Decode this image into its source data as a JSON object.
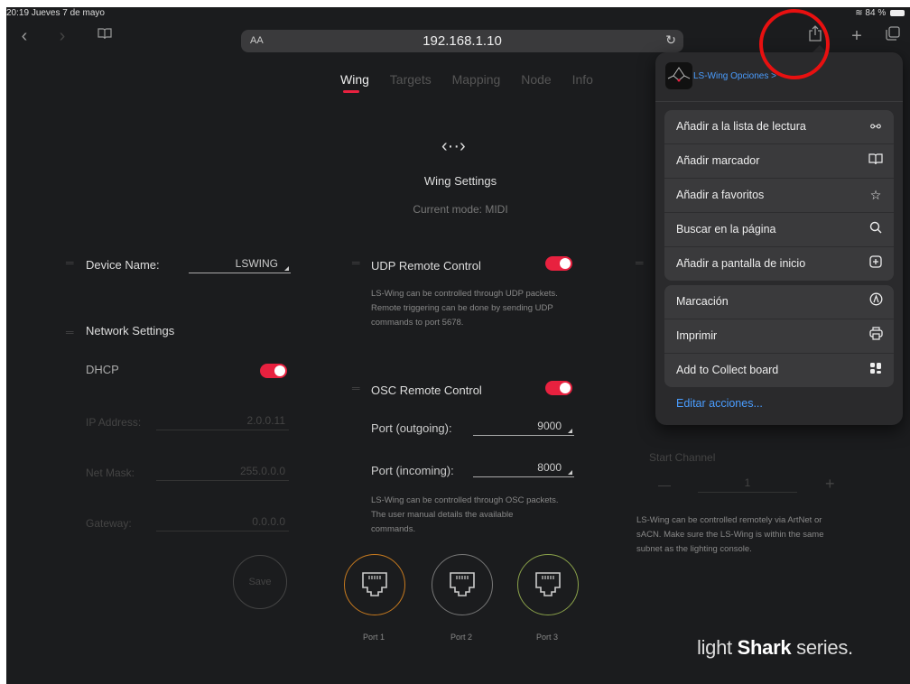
{
  "status": {
    "time": "20:19",
    "date": "Jueves 7 de mayo",
    "battery": "84 %"
  },
  "browser": {
    "text_size": "AA",
    "url": "192.168.1.10"
  },
  "tabs": [
    "Wing",
    "Targets",
    "Mapping",
    "Node",
    "Info"
  ],
  "wing": {
    "title": "Wing Settings",
    "mode": "Current mode: MIDI"
  },
  "left": {
    "device_name_label": "Device Name:",
    "device_name_value": "LSWING",
    "network_settings": "Network Settings",
    "dhcp": "DHCP",
    "dhcp_on": true,
    "ip_label": "IP Address:",
    "ip_value": "2.0.0.11",
    "mask_label": "Net Mask:",
    "mask_value": "255.0.0.0",
    "gateway_label": "Gateway:",
    "gateway_value": "0.0.0.0",
    "save": "Save"
  },
  "middle": {
    "udp_label": "UDP Remote Control",
    "udp_desc": [
      "LS-Wing can be controlled through UDP packets.",
      "Remote triggering can be done by sending UDP",
      "commands to port 5678."
    ],
    "osc_label": "OSC Remote Control",
    "port_out_label": "Port (outgoing):",
    "port_out_value": "9000",
    "port_in_label": "Port (incoming):",
    "port_in_value": "8000",
    "osc_desc": [
      "LS-Wing can be controlled through OSC packets.",
      "The user manual details the available",
      "commands."
    ],
    "ports": [
      {
        "label": "Port 1",
        "color": "#c77a1e"
      },
      {
        "label": "Port 2",
        "color": "#777777"
      },
      {
        "label": "Port 3",
        "color": "#8aa14a"
      }
    ]
  },
  "right": {
    "start_channel_label": "Start Channel",
    "minus": "—",
    "plus": "+",
    "channel_value": "1",
    "desc": [
      "LS-Wing can be controlled remotely via ArtNet or",
      "sACN. Make sure the LS-Wing is within the same",
      "subnet as the lighting console."
    ]
  },
  "brand": {
    "light": "light",
    "shark": "Shark",
    "series": " series."
  },
  "share_menu": {
    "app_title": "LS-Wing Opciones >",
    "group1": [
      {
        "label": "Añadir a la lista de lectura",
        "icon": "glasses-icon",
        "glyph": "○○"
      },
      {
        "label": "Añadir marcador",
        "icon": "book-icon",
        "glyph": "📖"
      },
      {
        "label": "Añadir a favoritos",
        "icon": "star-icon",
        "glyph": "☆"
      },
      {
        "label": "Buscar en la página",
        "icon": "search-icon",
        "glyph": "⚲"
      },
      {
        "label": "Añadir a pantalla de inicio",
        "icon": "add-square-icon",
        "glyph": "⊞"
      }
    ],
    "group2": [
      {
        "label": "Marcación",
        "icon": "markup-icon",
        "glyph": "Ⓐ"
      },
      {
        "label": "Imprimir",
        "icon": "print-icon",
        "glyph": "⎙"
      },
      {
        "label": "Add to Collect board",
        "icon": "collect-icon",
        "glyph": "▚"
      }
    ],
    "edit_actions": "Editar acciones..."
  },
  "colors": {
    "accent": "#e8213f",
    "link": "#4a9dff",
    "annotation": "#e81010"
  }
}
